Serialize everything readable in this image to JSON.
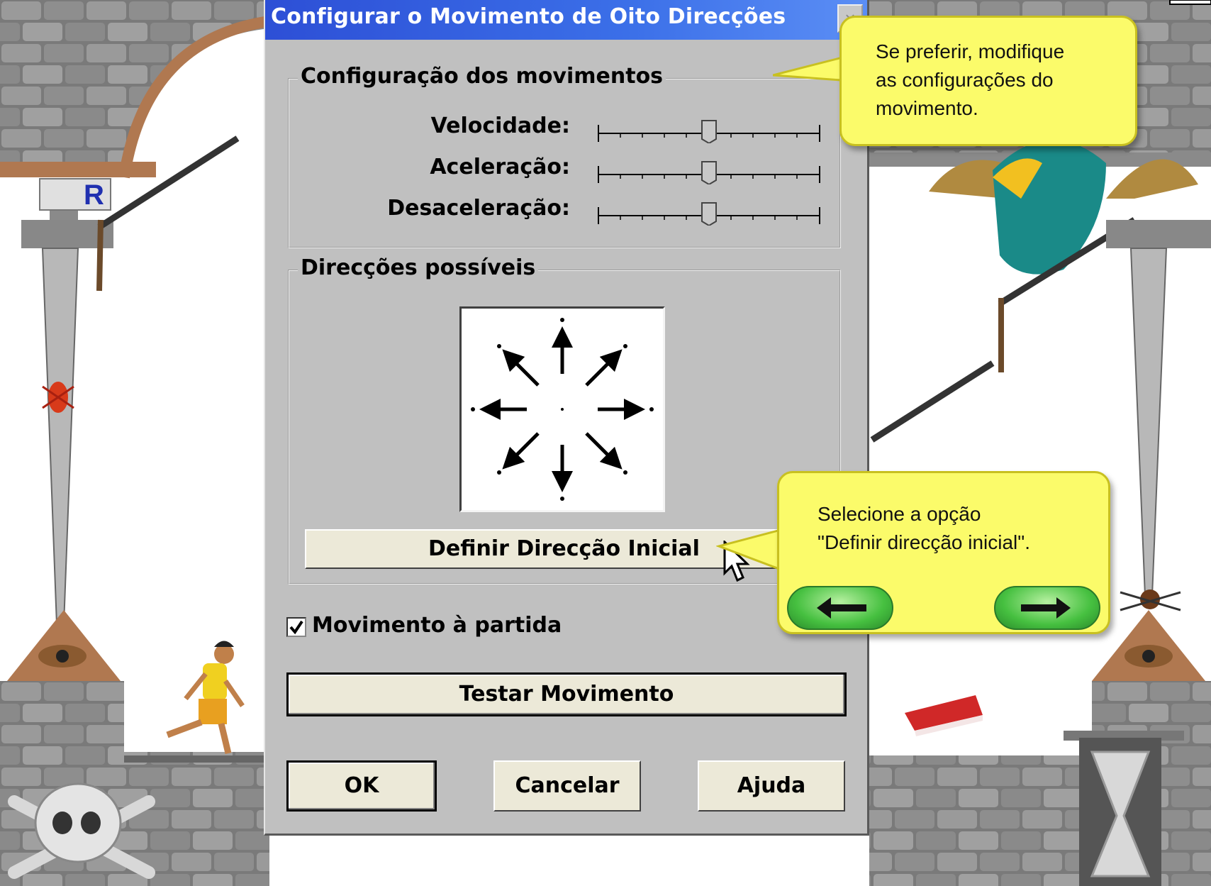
{
  "dialog": {
    "title": "Configurar o Movimento de Oito Direcções",
    "close_label": "×",
    "settings_group": {
      "label": "Configuração dos movimentos",
      "sliders": [
        {
          "label": "Velocidade:",
          "value": 0.5
        },
        {
          "label": "Aceleração:",
          "value": 0.5
        },
        {
          "label": "Desaceleração:",
          "value": 0.5
        }
      ]
    },
    "directions_group": {
      "label": "Direcções possíveis",
      "set_initial_button": "Definir Direcção Inicial"
    },
    "start_movement": {
      "label": "Movimento à partida",
      "checked": true
    },
    "test_button": "Testar Movimento",
    "ok_button": "OK",
    "cancel_button": "Cancelar",
    "help_button": "Ajuda"
  },
  "tooltips": {
    "top": {
      "line1": "Se preferir, modifique",
      "line2": "as configurações do",
      "line3": "movimento."
    },
    "bottom": {
      "line1": "Selecione a opção",
      "line2": "\"Definir direcção inicial\"."
    },
    "prev_icon": "arrow-left-icon",
    "next_icon": "arrow-right-icon"
  },
  "scene": {
    "badge_letter": "R",
    "colors": {
      "brick": "#8c8c8c",
      "brick_dark": "#5e5e5e",
      "sky": "#ffffff",
      "title_blue": "#2d4fd6",
      "tooltip_yellow": "#fbfb6a"
    }
  }
}
